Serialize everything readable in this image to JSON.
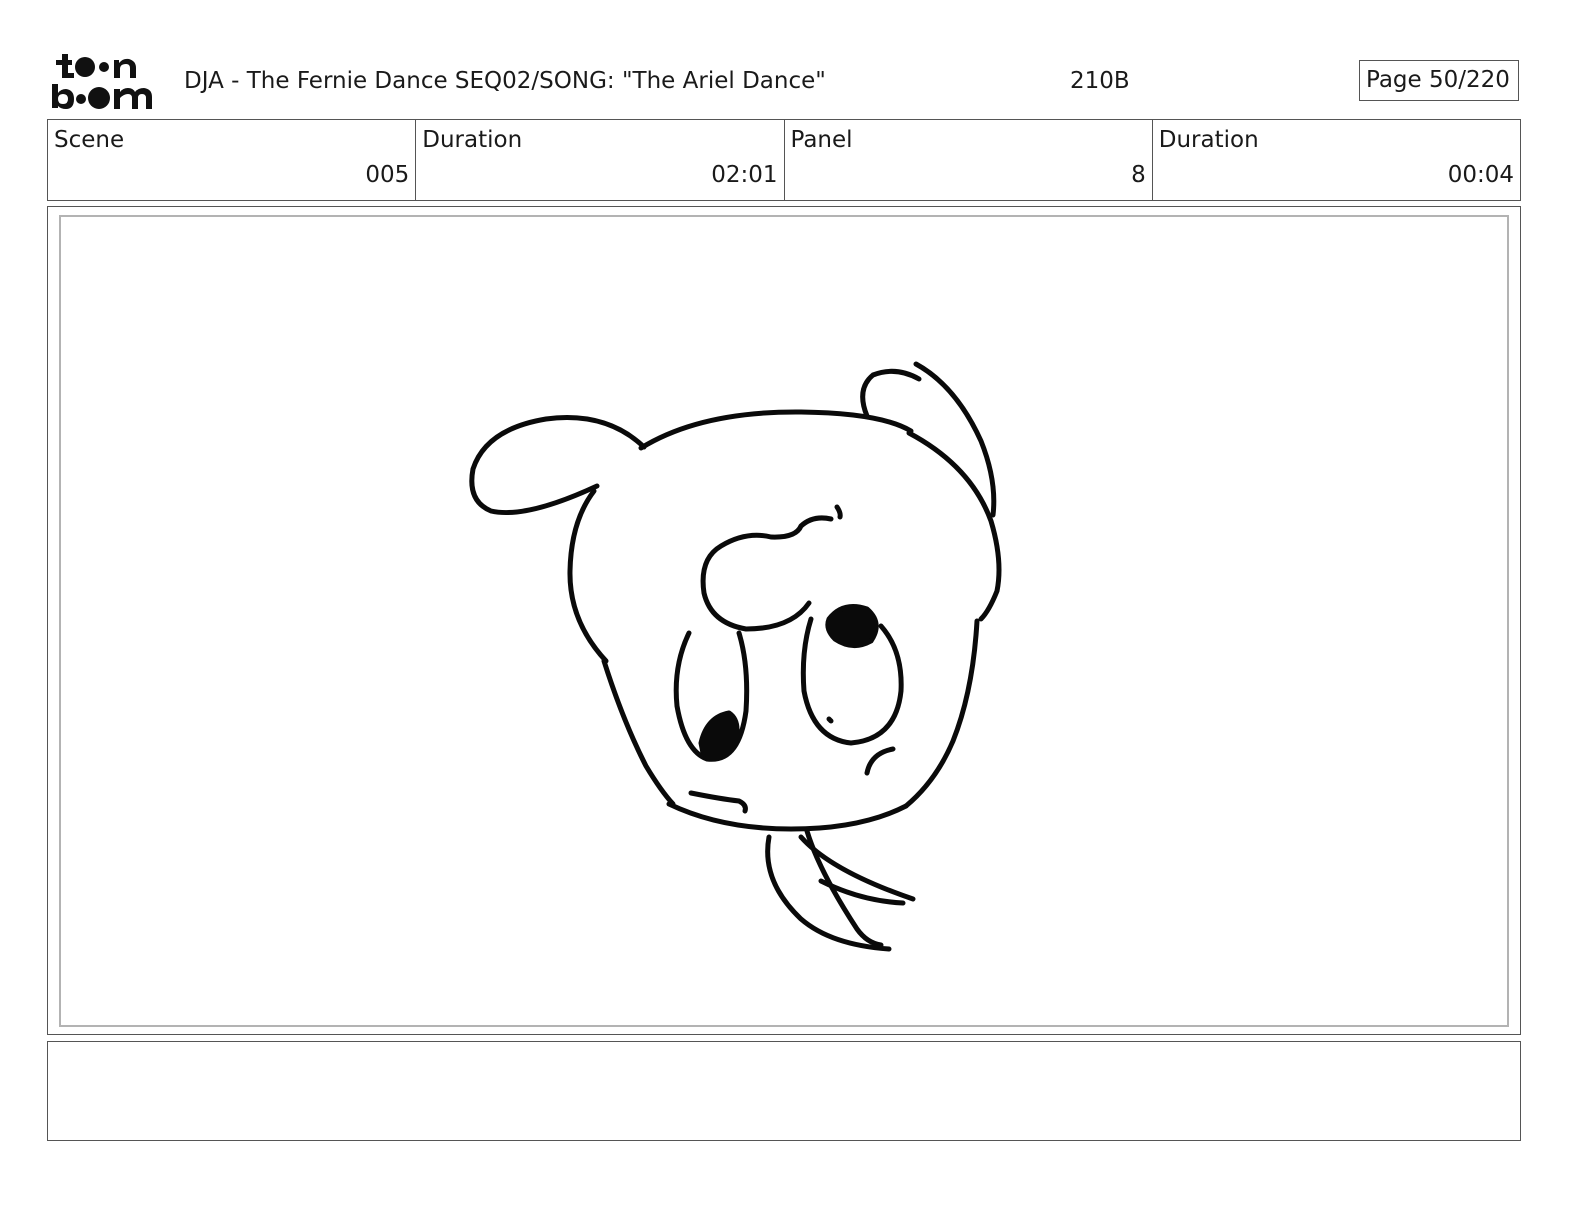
{
  "header": {
    "logo_text": "toon boom",
    "project_title": "DJA - The Fernie Dance  SEQ02/SONG: \"The Ariel Dance\"",
    "panel_code": "210B",
    "page_label": "Page  50/220"
  },
  "info": {
    "scene_label": "Scene",
    "scene_value": "005",
    "scene_duration_label": "Duration",
    "scene_duration_value": "02:01",
    "panel_label": "Panel",
    "panel_value": "8",
    "panel_duration_label": "Duration",
    "panel_duration_value": "00:04"
  },
  "frame": {
    "sketch": "rough-character-head-sketch"
  },
  "notes": {
    "text": ""
  }
}
